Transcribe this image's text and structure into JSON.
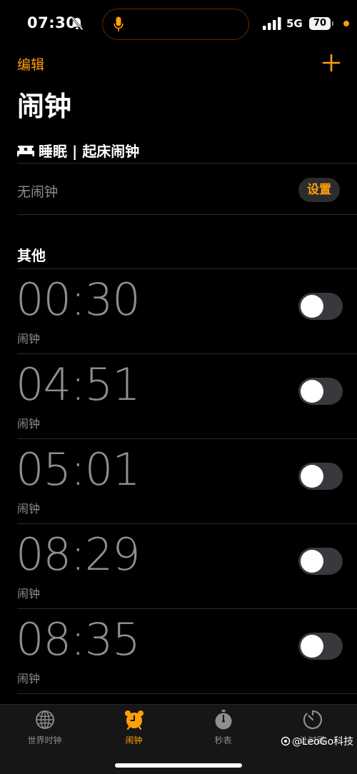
{
  "status_bar": {
    "time": "07:30",
    "network": "5G",
    "battery": "70",
    "icons": [
      "bell-slash-icon",
      "mic-icon",
      "signal-icon",
      "battery-icon"
    ]
  },
  "header": {
    "edit_label": "编辑",
    "add_icon": "plus-icon",
    "title": "闹钟"
  },
  "sleep_section": {
    "icon": "bed-icon",
    "title": "睡眠 | 起床闹钟",
    "status": "无闹钟",
    "setup_label": "设置"
  },
  "other_section": {
    "title": "其他"
  },
  "alarms": [
    {
      "time": "00:30",
      "label": "闹钟",
      "enabled": false
    },
    {
      "time": "04:51",
      "label": "闹钟",
      "enabled": false
    },
    {
      "time": "05:01",
      "label": "闹钟",
      "enabled": false
    },
    {
      "time": "08:29",
      "label": "闹钟",
      "enabled": false
    },
    {
      "time": "08:35",
      "label": "闹钟",
      "enabled": false
    }
  ],
  "tab_bar": {
    "tabs": [
      {
        "label": "世界时钟",
        "icon": "globe-icon",
        "active": false
      },
      {
        "label": "闹钟",
        "icon": "alarm-clock-icon",
        "active": true
      },
      {
        "label": "秒表",
        "icon": "stopwatch-icon",
        "active": false
      },
      {
        "label": "计时器",
        "icon": "timer-icon",
        "active": false
      }
    ]
  },
  "watermark": "@LeoGo科技",
  "colors": {
    "accent": "#ff9f0a",
    "background": "#000000",
    "secondary_text": "#8e8e93",
    "toggle_off": "#39393d"
  }
}
